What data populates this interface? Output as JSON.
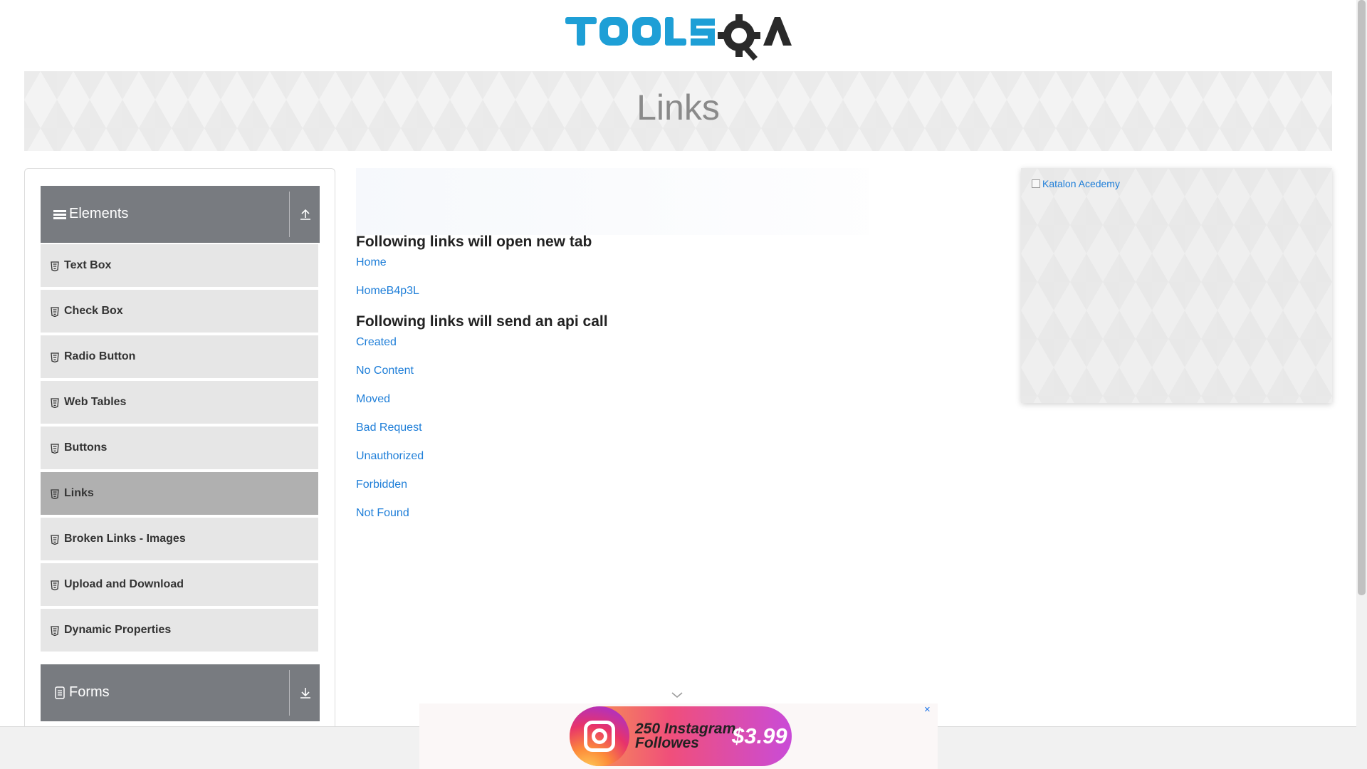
{
  "header": {
    "logo_text": "TOOLSQA",
    "logo_colors": {
      "text": "#1e9fd6",
      "gear": "#2a2a2a"
    }
  },
  "banner": {
    "title": "Links"
  },
  "sidebar": {
    "elements_group": {
      "label": "Elements",
      "items": [
        {
          "label": "Text Box"
        },
        {
          "label": "Check Box"
        },
        {
          "label": "Radio Button"
        },
        {
          "label": "Web Tables"
        },
        {
          "label": "Buttons"
        },
        {
          "label": "Links",
          "active": true
        },
        {
          "label": "Broken Links - Images"
        },
        {
          "label": "Upload and Download"
        },
        {
          "label": "Dynamic Properties"
        }
      ]
    },
    "forms_group": {
      "label": "Forms"
    }
  },
  "main": {
    "new_tab_section": {
      "title": "Following links will open new tab",
      "links": [
        "Home",
        "HomeB4p3L"
      ]
    },
    "api_section": {
      "title": "Following links will send an api call",
      "links": [
        "Created",
        "No Content",
        "Moved",
        "Bad Request",
        "Unauthorized",
        "Forbidden",
        "Not Found"
      ]
    }
  },
  "right_ad": {
    "image_alt": "Katalon Acedemy"
  },
  "bottom_ad": {
    "line1": "250 Instagram",
    "line2": "Followes",
    "price": "$3.99",
    "close_label": "×"
  },
  "colors": {
    "link": "#1e7ed8",
    "sidebar_header": "#787b80",
    "menu_item": "#e6e6e6",
    "menu_item_active": "#b0b0b0",
    "banner_title": "#8a8a8a"
  }
}
